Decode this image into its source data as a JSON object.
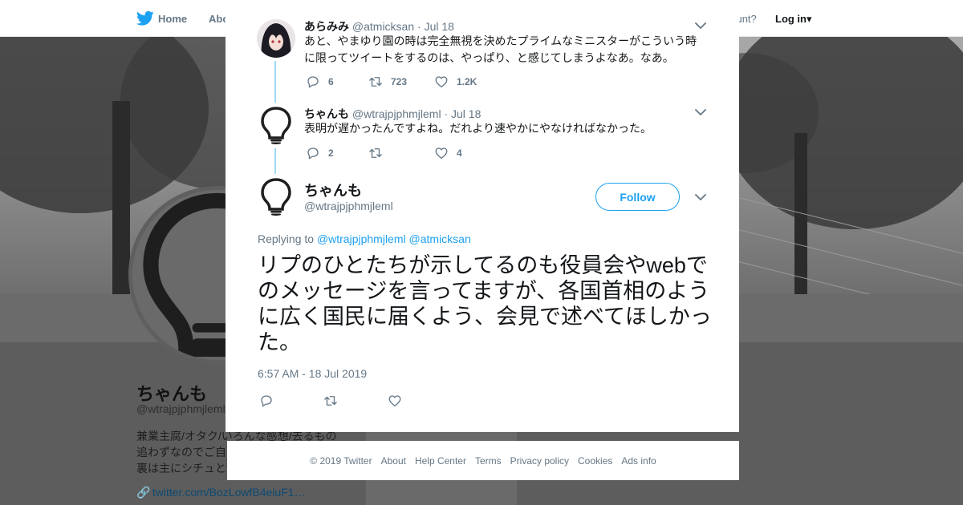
{
  "nav": {
    "home_label": "Home",
    "about_label": "Abo",
    "account_prompt": "account?",
    "login_label": "Log in"
  },
  "profile": {
    "name": "ちゃんも",
    "handle": "@wtrajpjphmjleml",
    "bio_lines": [
      "兼業主腐/オタク/いろんな感想/去るもの",
      "追わずなのでご自",
      "裏は主にシチュと"
    ],
    "link": "twitter.com/BozLowfB4eiuF1…",
    "ads_info_faded": "Ads info"
  },
  "thread": [
    {
      "name": "あらみみ",
      "handle": "@atmicksan",
      "date": "· Jul 18",
      "text": "あと、やまゆり園の時は完全無視を決めたプライムなミニスターがこういう時に限ってツイートをするのは、やっぱり、と感じてしまうよなあ。なあ。",
      "replies": "6",
      "retweets": "723",
      "likes": "1.2K"
    },
    {
      "name": "ちゃんも",
      "handle": "@wtrajpjphmjleml",
      "date": "· Jul 18",
      "text": "表明が遅かったんですよね。だれより速やかにやなければなかった。",
      "replies": "2",
      "retweets": "",
      "likes": "4"
    }
  ],
  "main_tweet": {
    "name": "ちゃんも",
    "handle": "@wtrajpjphmjleml",
    "follow_label": "Follow",
    "replying_prefix": "Replying to",
    "replying_to": [
      "@wtrajpjphmjleml",
      "@atmicksan"
    ],
    "text": "リプのひとたちが示してるのも役員会やwebでのメッセージを言ってますが、各国首相のように広く国民に届くよう、会見で述べてほしかった。",
    "timestamp": "6:57 AM - 18 Jul 2019"
  },
  "footer": {
    "links": [
      "© 2019 Twitter",
      "About",
      "Help Center",
      "Terms",
      "Privacy policy",
      "Cookies",
      "Ads info"
    ]
  },
  "colors": {
    "accent": "#1da1f2",
    "thread_line": "#9fd8f5",
    "text_primary": "#14171a",
    "text_secondary": "#657786"
  },
  "icons": {
    "brand": "twitter-bird-icon",
    "close": "close-icon",
    "reply": "reply-icon",
    "retweet": "retweet-icon",
    "like": "heart-icon",
    "menu": "chevron-down-icon",
    "link": "link-icon"
  }
}
